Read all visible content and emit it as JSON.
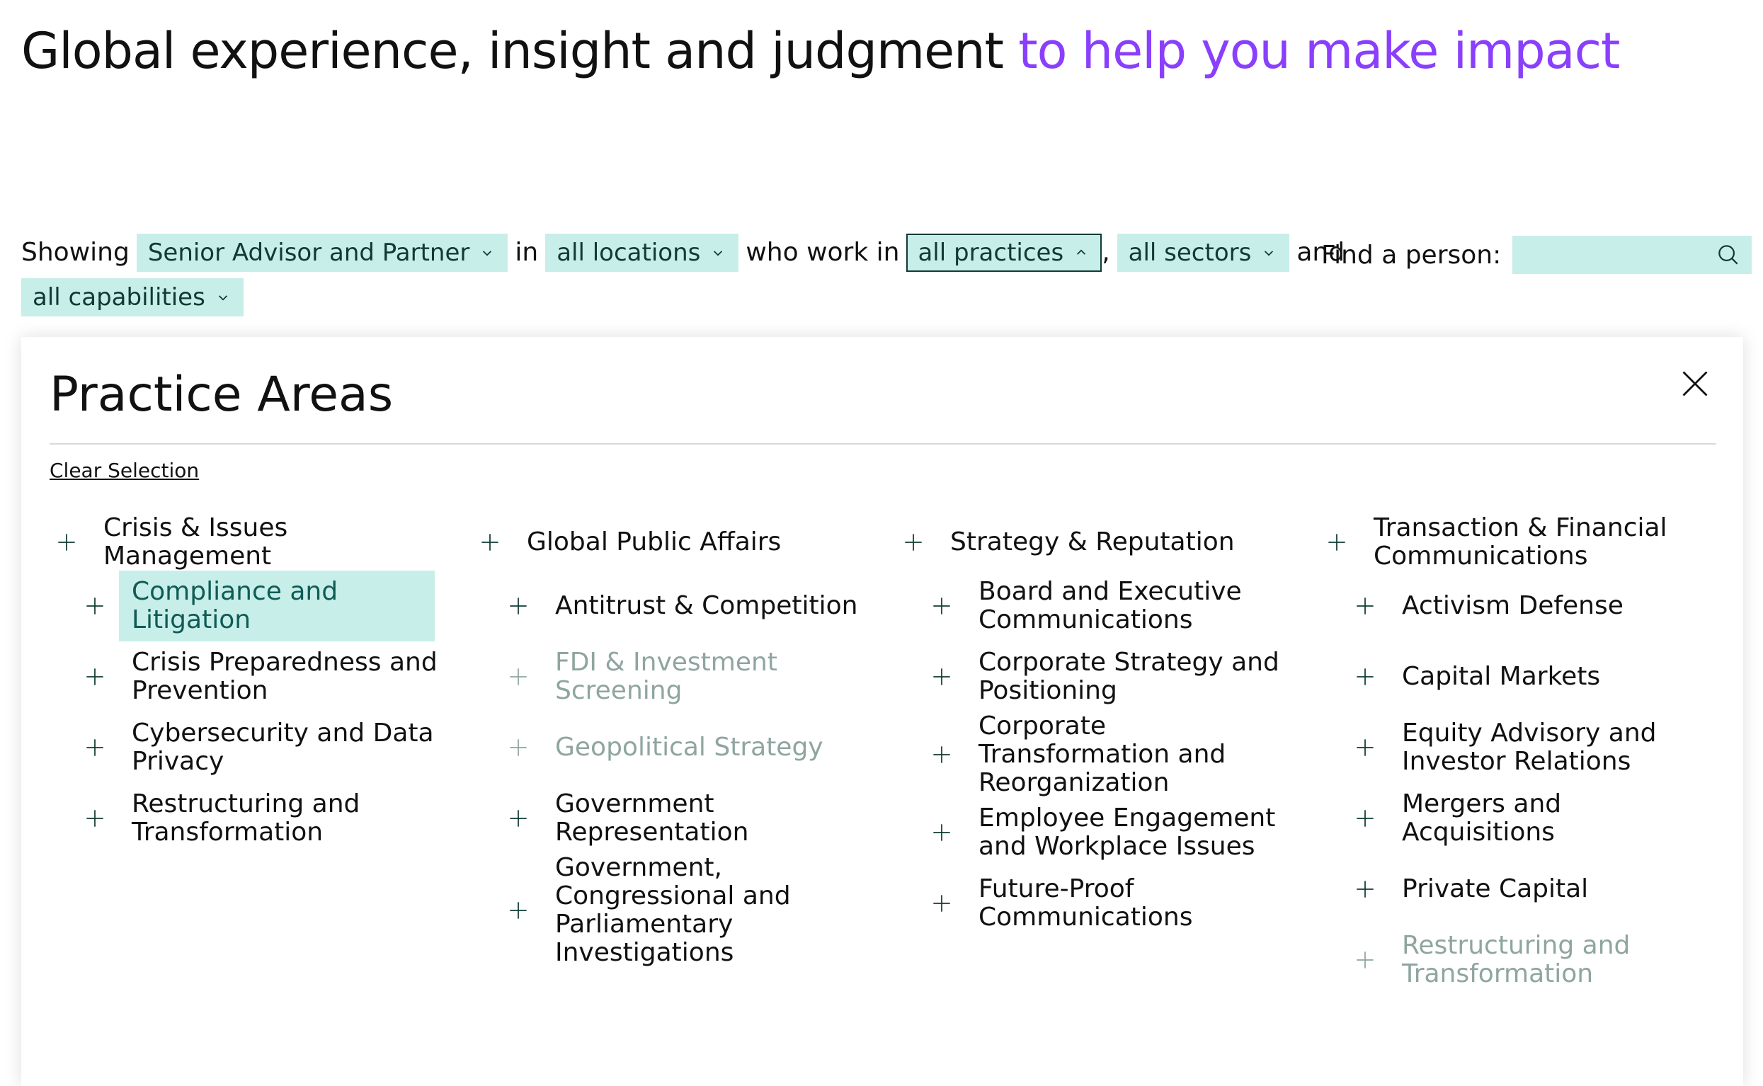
{
  "headline": {
    "part1": "Global experience, insight and judgment ",
    "part2": "to help you make impact"
  },
  "filters": {
    "showing_label": "Showing",
    "role": "Senior Advisor and Partner",
    "in_label": "in",
    "location": "all locations",
    "who_work_label": "who work in",
    "practice": "all practices",
    "comma": ",",
    "sector": "all sectors",
    "and_label": "and",
    "capability": "all capabilities"
  },
  "search": {
    "label": "Find a person:",
    "value": ""
  },
  "panel": {
    "title": "Practice Areas",
    "clear_label": "Clear Selection",
    "columns": [
      {
        "heading": "Crisis & Issues Management",
        "items": [
          {
            "label": "Compliance and Litigation",
            "state": "selected"
          },
          {
            "label": "Crisis Preparedness and Prevention",
            "state": "default"
          },
          {
            "label": "Cybersecurity and Data Privacy",
            "state": "default"
          },
          {
            "label": "Restructuring and Transformation",
            "state": "default"
          }
        ]
      },
      {
        "heading": "Global Public Affairs",
        "items": [
          {
            "label": "Antitrust & Competition",
            "state": "default"
          },
          {
            "label": "FDI & Investment Screening",
            "state": "disabled"
          },
          {
            "label": "Geopolitical Strategy",
            "state": "disabled"
          },
          {
            "label": "Government Representation",
            "state": "default"
          },
          {
            "label": "Government, Congressional and Parliamentary Investigations",
            "state": "default"
          }
        ]
      },
      {
        "heading": "Strategy & Reputation",
        "items": [
          {
            "label": "Board and Executive Communications",
            "state": "default"
          },
          {
            "label": "Corporate Strategy and Positioning",
            "state": "default"
          },
          {
            "label": "Corporate Transformation and Reorganization",
            "state": "default"
          },
          {
            "label": "Employee Engagement and Workplace Issues",
            "state": "default"
          },
          {
            "label": "Future-Proof Communications",
            "state": "default"
          }
        ]
      },
      {
        "heading": "Transaction & Financial Communications",
        "items": [
          {
            "label": "Activism Defense",
            "state": "default"
          },
          {
            "label": "Capital Markets",
            "state": "default"
          },
          {
            "label": "Equity Advisory and Investor Relations",
            "state": "default"
          },
          {
            "label": "Mergers and Acquisitions",
            "state": "default"
          },
          {
            "label": "Private Capital",
            "state": "default"
          },
          {
            "label": "Restructuring and Transformation",
            "state": "disabled"
          }
        ]
      }
    ]
  },
  "colors": {
    "accent": "#8a3ffc",
    "chip_bg": "#c8eeea",
    "chip_text": "#0f3b33",
    "disabled": "#8fa5a0"
  },
  "icons": [
    "chevron-down-icon",
    "chevron-up-icon",
    "search-icon",
    "close-icon",
    "plus-icon"
  ]
}
